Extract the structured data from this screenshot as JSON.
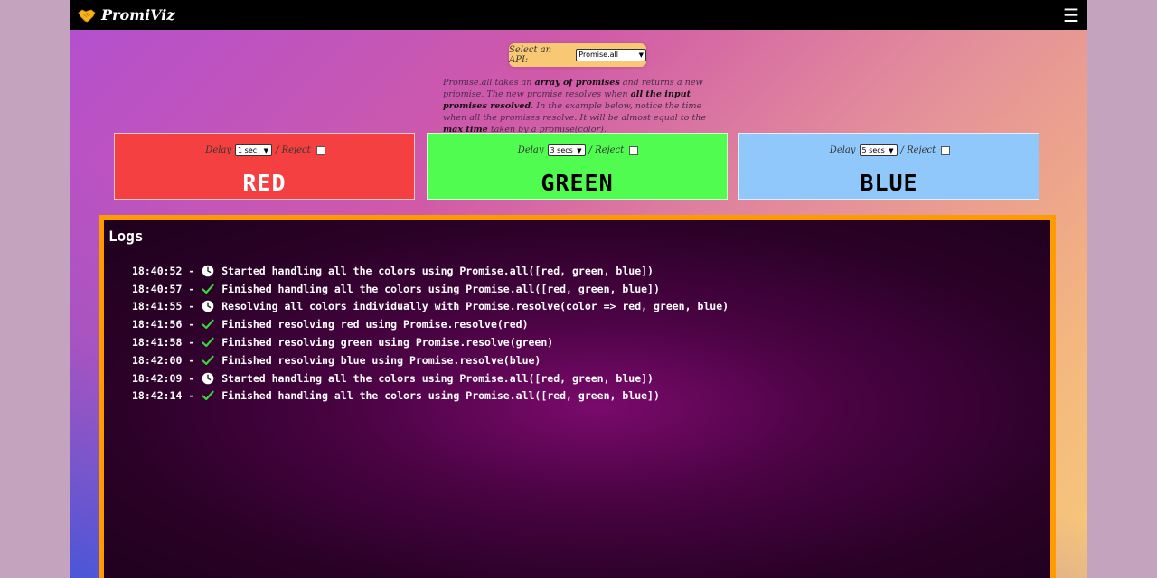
{
  "navbar": {
    "brand": "PromiViz",
    "logo_icon": "handshake-icon",
    "menu_icon": "hamburger-menu-icon",
    "menu_glyph": "☰"
  },
  "api_selector": {
    "label": "Select an API:",
    "selected": "Promise.all"
  },
  "description": {
    "p1": "Promise.all takes an ",
    "b1": "array of promises",
    "p2": " and returns a new priomise. The new promise resolves when ",
    "b2": "all the input promises resolved",
    "p3": ". In the example below, notice the time when all the promises resolve. It will be almost equal to the ",
    "b3": "max time",
    "p4": " taken by a promise(color)."
  },
  "colors": [
    {
      "name": "RED",
      "delay": "1 sec",
      "delay_label": "Delay",
      "reject_label": "/ Reject",
      "bg": "#f44040"
    },
    {
      "name": "GREEN",
      "delay": "3 secs",
      "delay_label": "Delay",
      "reject_label": "/ Reject",
      "bg": "#50fc50"
    },
    {
      "name": "BLUE",
      "delay": "5 secs",
      "delay_label": "Delay",
      "reject_label": "/ Reject",
      "bg": "#90c8fc"
    }
  ],
  "logs": {
    "title": "Logs",
    "entries": [
      {
        "time": "18:40:52",
        "icon": "clock-icon",
        "text": "Started handling all the colors using Promise.all([red, green, blue])"
      },
      {
        "time": "18:40:57",
        "icon": "checkmark-icon",
        "text": "Finished handling all the colors using Promise.all([red, green, blue])"
      },
      {
        "time": "18:41:55",
        "icon": "clock-icon",
        "text": "Resolving all colors individually with Promise.resolve(color => red, green, blue)"
      },
      {
        "time": "18:41:56",
        "icon": "checkmark-icon",
        "text": "Finished resolving red using Promise.resolve(red)"
      },
      {
        "time": "18:41:58",
        "icon": "checkmark-icon",
        "text": "Finished resolving green using Promise.resolve(green)"
      },
      {
        "time": "18:42:00",
        "icon": "checkmark-icon",
        "text": "Finished resolving blue using Promise.resolve(blue)"
      },
      {
        "time": "18:42:09",
        "icon": "clock-icon",
        "text": "Started handling all the colors using Promise.all([red, green, blue])"
      },
      {
        "time": "18:42:14",
        "icon": "checkmark-icon",
        "text": "Finished handling all the colors using Promise.all([red, green, blue])"
      }
    ]
  },
  "theme": {
    "panel_border": "#ff9a00",
    "selector_bg": "#f8c874"
  }
}
